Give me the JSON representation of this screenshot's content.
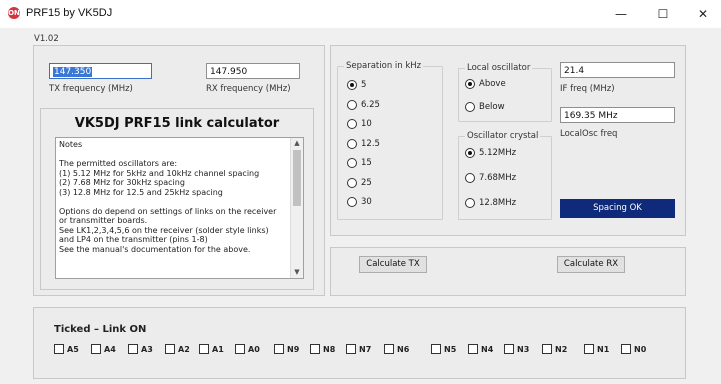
{
  "window": {
    "title": "PRF15 by VK5DJ",
    "icon_text": "ON",
    "minimize_glyph": "—",
    "maximize_glyph": "☐",
    "close_glyph": "✕"
  },
  "version": "V1.02",
  "frequencies": {
    "tx_value": "147.350",
    "tx_label": "TX frequency (MHz)",
    "rx_value": "147.950",
    "rx_label": "RX frequency (MHz)"
  },
  "calculator": {
    "heading": "VK5DJ PRF15 link calculator",
    "notes_lines": [
      "Notes",
      "",
      "The permitted oscillators are:",
      "(1) 5.12 MHz for 5kHz and 10kHz channel spacing",
      "(2) 7.68 MHz for 30kHz spacing",
      "(3) 12.8 MHz for 12.5 and 25kHz spacing",
      "",
      "Options do depend on settings of links on the receiver",
      "or transmitter boards.",
      "See LK1,2,3,4,5,6 on the receiver (solder style links)",
      "and LP4 on the transmitter (pins 1-8)",
      "See the manual's documentation for the above."
    ]
  },
  "separation": {
    "title": "Separation in kHz",
    "options": [
      "5",
      "6.25",
      "10",
      "12.5",
      "15",
      "25",
      "30"
    ],
    "selected_index": 0
  },
  "local_oscillator": {
    "title": "Local oscillator",
    "options": [
      "Above",
      "Below"
    ],
    "selected_index": 0
  },
  "oscillator_crystal": {
    "title": "Oscillator crystal",
    "options": [
      "5.12MHz",
      "7.68MHz",
      "12.8MHz"
    ],
    "selected_index": 0
  },
  "if_freq": {
    "value": "21.4",
    "label": "IF freq (MHz)"
  },
  "localosc_freq": {
    "value": "169.35 MHz",
    "label": "LocalOsc freq"
  },
  "status": {
    "text": "Spacing OK",
    "color": "#0f2a7a"
  },
  "buttons": {
    "calc_tx": "Calculate TX",
    "calc_rx": "Calculate RX"
  },
  "links": {
    "title": "Ticked  –  Link ON",
    "items": [
      "A5",
      "A4",
      "A3",
      "A2",
      "A1",
      "A0",
      "N9",
      "N8",
      "N7",
      "N6",
      "N5",
      "N4",
      "N3",
      "N2",
      "N1",
      "N0"
    ]
  }
}
